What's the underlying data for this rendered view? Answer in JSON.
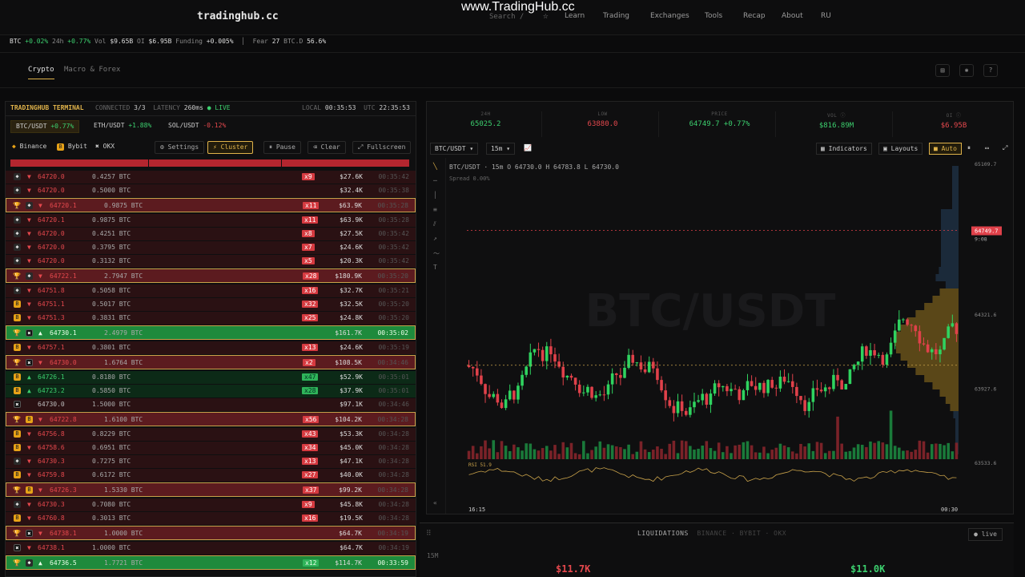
{
  "nav": {
    "logo": "tradinghub.cc",
    "watermark": "www.TradingHub.cc",
    "search": "Search  /",
    "links": [
      "Learn",
      "Trading",
      "Exchanges",
      "Tools",
      "Recap",
      "About",
      "RU"
    ]
  },
  "ticker": {
    "asset": "BTC",
    "chg": "+0.02%",
    "h24_label": "24h",
    "h24": "+0.77%",
    "vol_label": "Vol",
    "vol": "$9.65B",
    "oi_label": "OI",
    "oi": "$6.95B",
    "funding_label": "Funding",
    "funding": "+0.005%",
    "fear_label": "Fear",
    "fear": "27",
    "btcd_label": "BTC.D",
    "btcd": "56.6%"
  },
  "tabs": [
    "Crypto",
    "Macro & Forex"
  ],
  "terminal": {
    "title": "TRADINGHUB TERMINAL",
    "connected_label": "CONNECTED",
    "connected": "3/3",
    "latency_label": "LATENCY",
    "latency": "260ms",
    "live": "● LIVE",
    "local_label": "LOCAL",
    "local": "00:35:53",
    "utc_label": "UTC",
    "utc": "22:35:53"
  },
  "pairs": [
    {
      "name": "BTC/USDT",
      "chg": "+0.77%"
    },
    {
      "name": "ETH/USDT",
      "chg": "+1.88%"
    },
    {
      "name": "SOL/USDT",
      "chg": "-0.12%"
    }
  ],
  "exchanges": [
    "Binance",
    "Bybit",
    "OKX"
  ],
  "controls": [
    "Settings",
    "Cluster",
    "Pause",
    "Clear",
    "Fullscreen"
  ],
  "trades": [
    {
      "ex": "bn",
      "side": "s",
      "price": "64720.0",
      "qty": "0.4257 BTC",
      "mult": "x9",
      "usd": "$27.6K",
      "time": "00:35:42",
      "big": false
    },
    {
      "ex": "bn",
      "side": "s",
      "price": "64720.0",
      "qty": "0.5000 BTC",
      "mult": "",
      "usd": "$32.4K",
      "time": "00:35:38",
      "big": false
    },
    {
      "ex": "bn",
      "side": "s",
      "price": "64720.1",
      "qty": "0.9875 BTC",
      "mult": "x11",
      "usd": "$63.9K",
      "time": "00:35:28",
      "big": true
    },
    {
      "ex": "bn",
      "side": "s",
      "price": "64720.1",
      "qty": "0.9875 BTC",
      "mult": "x11",
      "usd": "$63.9K",
      "time": "00:35:28",
      "big": false
    },
    {
      "ex": "bn",
      "side": "s",
      "price": "64720.0",
      "qty": "0.4251 BTC",
      "mult": "x8",
      "usd": "$27.5K",
      "time": "00:35:42",
      "big": false
    },
    {
      "ex": "bn",
      "side": "s",
      "price": "64720.0",
      "qty": "0.3795 BTC",
      "mult": "x7",
      "usd": "$24.6K",
      "time": "00:35:42",
      "big": false
    },
    {
      "ex": "bn",
      "side": "s",
      "price": "64720.0",
      "qty": "0.3132 BTC",
      "mult": "x5",
      "usd": "$20.3K",
      "time": "00:35:42",
      "big": false
    },
    {
      "ex": "bn",
      "side": "s",
      "price": "64722.1",
      "qty": "2.7947 BTC",
      "mult": "x28",
      "usd": "$180.9K",
      "time": "00:35:20",
      "big": true
    },
    {
      "ex": "bn",
      "side": "s",
      "price": "64751.8",
      "qty": "0.5058 BTC",
      "mult": "x16",
      "usd": "$32.7K",
      "time": "00:35:21",
      "big": false
    },
    {
      "ex": "by",
      "side": "s",
      "price": "64751.1",
      "qty": "0.5017 BTC",
      "mult": "x32",
      "usd": "$32.5K",
      "time": "00:35:20",
      "big": false
    },
    {
      "ex": "by",
      "side": "s",
      "price": "64751.3",
      "qty": "0.3831 BTC",
      "mult": "x25",
      "usd": "$24.8K",
      "time": "00:35:20",
      "big": false
    },
    {
      "ex": "ok",
      "side": "b",
      "price": "64730.1",
      "qty": "2.4979 BTC",
      "mult": "",
      "usd": "$161.7K",
      "time": "00:35:02",
      "big": true
    },
    {
      "ex": "by",
      "side": "s",
      "price": "64757.1",
      "qty": "0.3801 BTC",
      "mult": "x13",
      "usd": "$24.6K",
      "time": "00:35:19",
      "big": false
    },
    {
      "ex": "ok",
      "side": "s",
      "price": "64730.0",
      "qty": "1.6764 BTC",
      "mult": "x2",
      "usd": "$108.5K",
      "time": "00:34:46",
      "big": true
    },
    {
      "ex": "by",
      "side": "b",
      "price": "64726.1",
      "qty": "0.8180 BTC",
      "mult": "x47",
      "usd": "$52.9K",
      "time": "00:35:01",
      "big": false
    },
    {
      "ex": "by",
      "side": "b",
      "price": "64723.2",
      "qty": "0.5850 BTC",
      "mult": "x28",
      "usd": "$37.9K",
      "time": "00:35:01",
      "big": false
    },
    {
      "ex": "ok",
      "side": "n",
      "price": "64730.0",
      "qty": "1.5000 BTC",
      "mult": "",
      "usd": "$97.1K",
      "time": "00:34:46",
      "big": false
    },
    {
      "ex": "by",
      "side": "s",
      "price": "64722.8",
      "qty": "1.6100 BTC",
      "mult": "x56",
      "usd": "$104.2K",
      "time": "00:34:28",
      "big": true
    },
    {
      "ex": "by",
      "side": "s",
      "price": "64756.8",
      "qty": "0.8229 BTC",
      "mult": "x43",
      "usd": "$53.3K",
      "time": "00:34:28",
      "big": false
    },
    {
      "ex": "by",
      "side": "s",
      "price": "64758.6",
      "qty": "0.6951 BTC",
      "mult": "x34",
      "usd": "$45.0K",
      "time": "00:34:28",
      "big": false
    },
    {
      "ex": "bn",
      "side": "s",
      "price": "64730.3",
      "qty": "0.7275 BTC",
      "mult": "x13",
      "usd": "$47.1K",
      "time": "00:34:28",
      "big": false
    },
    {
      "ex": "by",
      "side": "s",
      "price": "64759.8",
      "qty": "0.6172 BTC",
      "mult": "x27",
      "usd": "$40.0K",
      "time": "00:34:28",
      "big": false
    },
    {
      "ex": "by",
      "side": "s",
      "price": "64726.3",
      "qty": "1.5330 BTC",
      "mult": "x37",
      "usd": "$99.2K",
      "time": "00:34:28",
      "big": true
    },
    {
      "ex": "bn",
      "side": "s",
      "price": "64730.3",
      "qty": "0.7080 BTC",
      "mult": "x9",
      "usd": "$45.8K",
      "time": "00:34:28",
      "big": false
    },
    {
      "ex": "by",
      "side": "s",
      "price": "64760.8",
      "qty": "0.3013 BTC",
      "mult": "x16",
      "usd": "$19.5K",
      "time": "00:34:28",
      "big": false
    },
    {
      "ex": "ok",
      "side": "s",
      "price": "64738.1",
      "qty": "1.0000 BTC",
      "mult": "",
      "usd": "$64.7K",
      "time": "00:34:19",
      "big": true
    },
    {
      "ex": "ok",
      "side": "s",
      "price": "64738.1",
      "qty": "1.0000 BTC",
      "mult": "",
      "usd": "$64.7K",
      "time": "00:34:19",
      "big": false
    },
    {
      "ex": "bn",
      "side": "b",
      "price": "64736.5",
      "qty": "1.7721 BTC",
      "mult": "x12",
      "usd": "$114.7K",
      "time": "00:33:59",
      "big": true
    }
  ],
  "stats": [
    {
      "k": "24H",
      "v": "65025.2",
      "c": "#3ccf6e"
    },
    {
      "k": "LOW",
      "v": "63880.0",
      "c": "#e5484d"
    },
    {
      "k": "PRICE",
      "v": "64749.7",
      "chg": "+0.77%",
      "c": "#3ccf6e"
    },
    {
      "k": "VOL ⓘ",
      "v": "$816.89M",
      "c": "#3ccf6e"
    },
    {
      "k": "OI ⓘ",
      "v": "$6.95B",
      "c": "#e5484d"
    }
  ],
  "chart_toolbar": {
    "symbol": "BTC/USDT ▾",
    "tf": "15m ▾",
    "indicators": "Indicators",
    "layouts": "Layouts",
    "auto": "Auto"
  },
  "chart_info": {
    "symbol": "BTC/USDT · 15m",
    "o_label": "O",
    "o": "64730.0",
    "h_label": "H",
    "h": "64783.8",
    "l_label": "L",
    "l": "64730.0",
    "spread_label": "Spread",
    "spread": "0.00%",
    "watermark": "BTC/USDT",
    "rsi_label": "RSI",
    "rsi": "51.9",
    "last_price": "64749.7",
    "countdown": "9:08",
    "x_start": "16:15",
    "x_end": "00:30"
  },
  "chart_data": {
    "type": "candlestick",
    "y_ticks": [
      65109.7,
      64321.6,
      63927.6,
      63533.6
    ],
    "ylim": [
      63533.6,
      65109.7
    ],
    "x_range": [
      "16:15",
      "00:30"
    ],
    "last_price": 64749.7,
    "series_count": 120
  },
  "liq": {
    "title": "LIQUIDATIONS",
    "sources": "BINANCE · BYBIT · OKX",
    "live": "● live",
    "tf": "15M",
    "short_val": "$11.7K",
    "long_val": "$11.0K"
  }
}
